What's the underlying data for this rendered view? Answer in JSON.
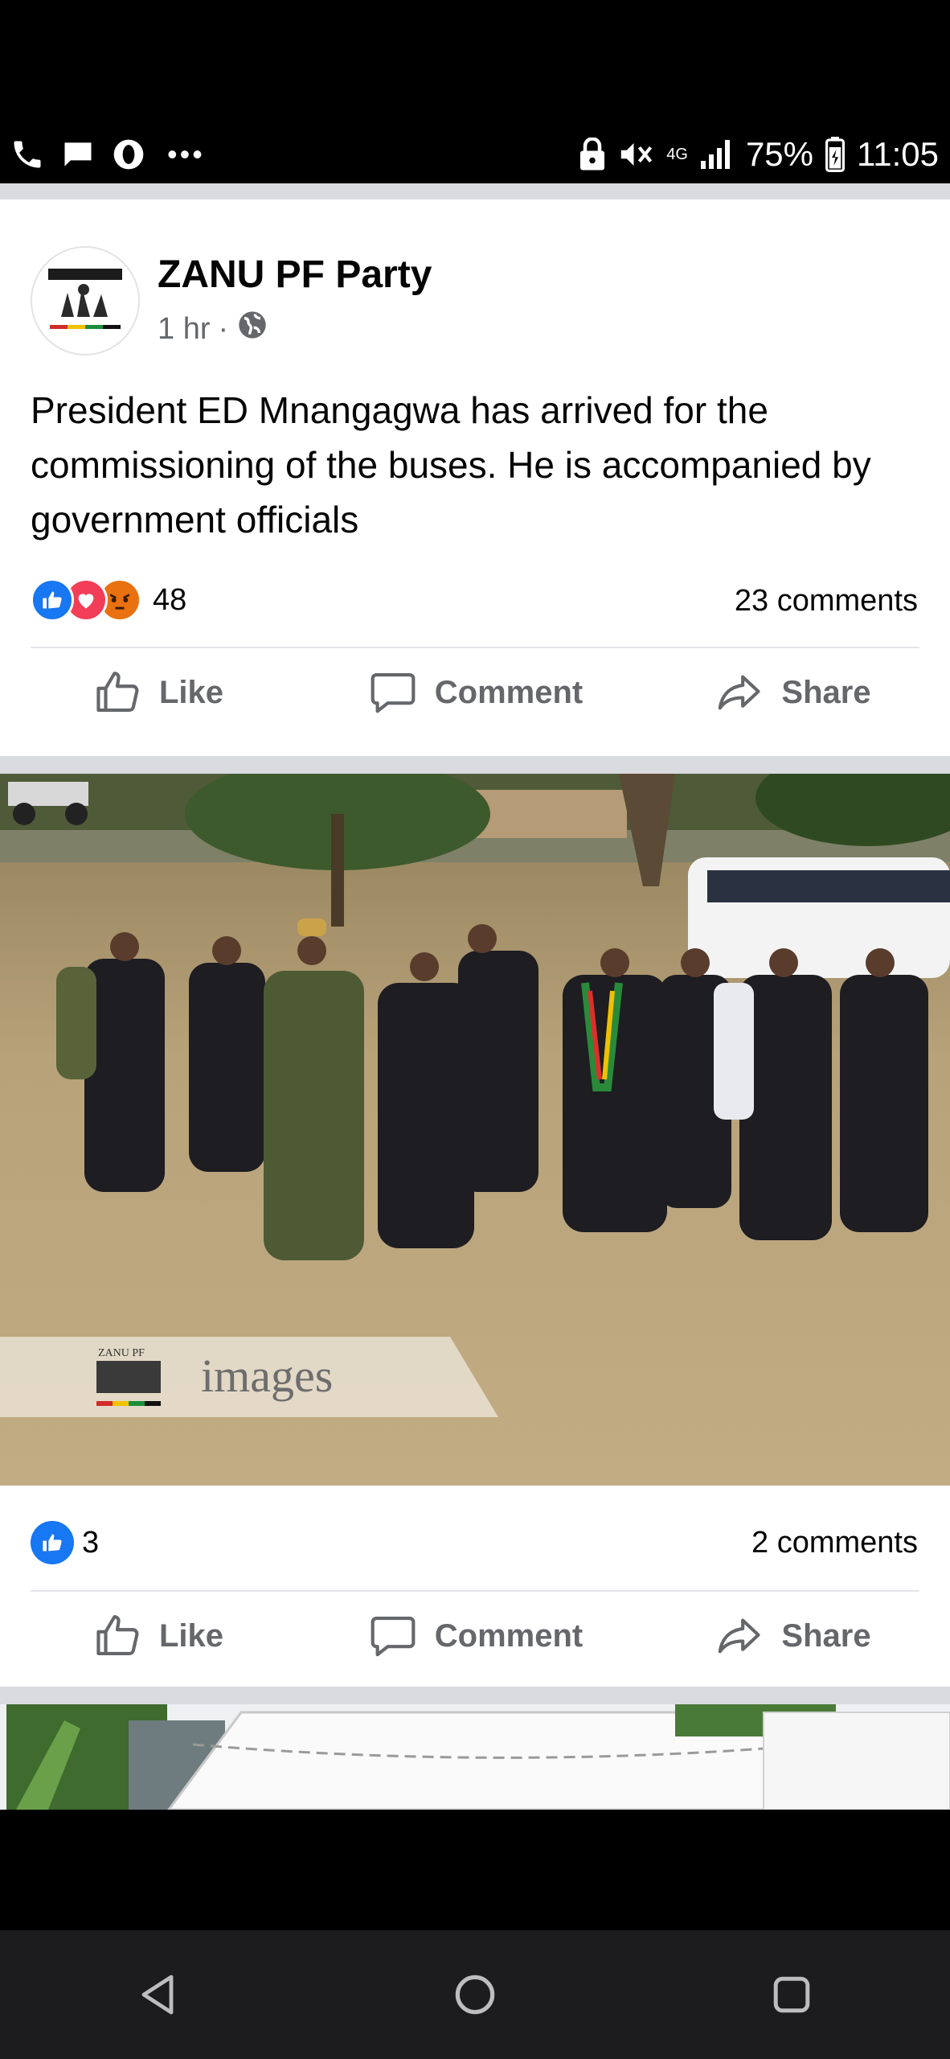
{
  "status_bar": {
    "network": "4G",
    "battery": "75%",
    "time": "11:05",
    "left_icons": [
      "phone-icon",
      "message-icon",
      "opera-icon",
      "more-dots-icon"
    ],
    "right_icons": [
      "lock-icon",
      "mute-icon",
      "network-icon",
      "signal-icon",
      "battery-icon"
    ]
  },
  "post": {
    "page_name": "ZANU PF Party",
    "time": "1 hr",
    "separator": "·",
    "audience_icon": "globe-icon",
    "text": "President ED Mnangagwa has arrived for the commissioning of the buses. He is accompanied by government officials",
    "reaction_icons": [
      "like-reaction-icon",
      "love-reaction-icon",
      "angry-reaction-icon"
    ],
    "reaction_count": "48",
    "comments": "23 comments",
    "actions": {
      "like": "Like",
      "comment": "Comment",
      "share": "Share"
    }
  },
  "photo_post": {
    "watermark_small": "ZANU PF",
    "watermark_text": "images",
    "reaction_count": "3",
    "comments": "2 comments",
    "actions": {
      "like": "Like",
      "comment": "Comment",
      "share": "Share"
    }
  },
  "nav": {
    "icons": [
      "back-icon",
      "home-icon",
      "recents-icon"
    ]
  },
  "colors": {
    "facebook_blue": "#1877f2",
    "love_red": "#f33e58",
    "angry_orange": "#e9710f",
    "secondary_text": "#65676b",
    "feed_background": "#d9dbdf"
  }
}
